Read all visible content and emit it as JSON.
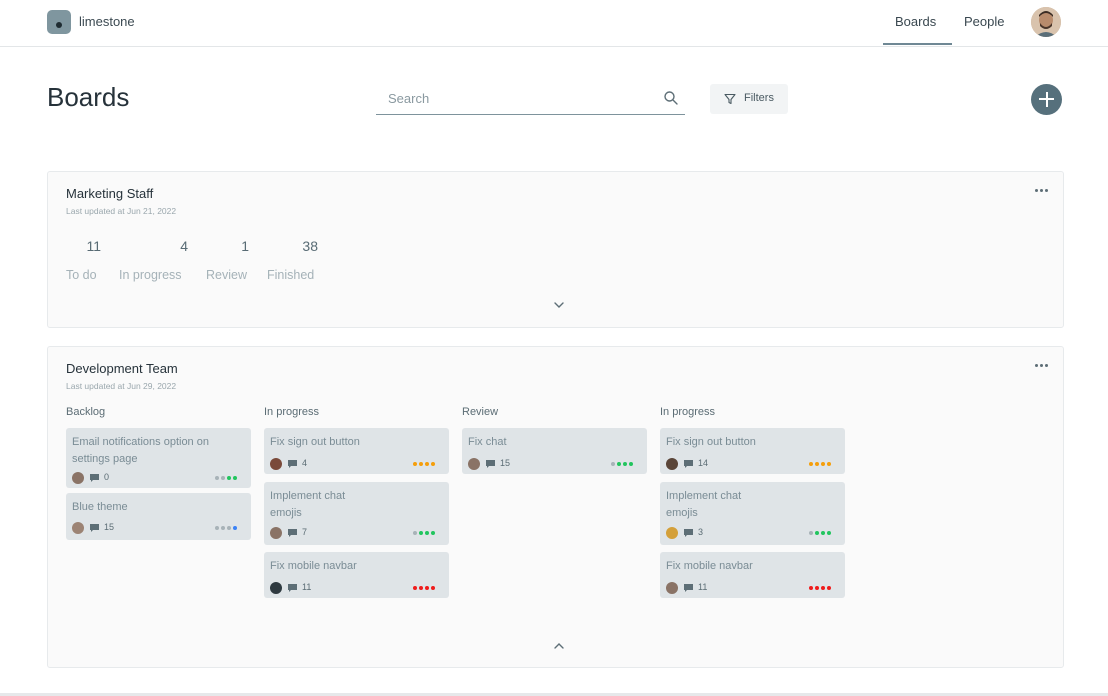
{
  "app": {
    "brand": "limestone"
  },
  "nav": {
    "boards": "Boards",
    "people": "People"
  },
  "page": {
    "title": "Boards"
  },
  "search": {
    "placeholder": "Search"
  },
  "filters": {
    "label": "Filters"
  },
  "colors": {
    "accent": "#56707c",
    "card": "#dfe4e7",
    "grey_dot": "#a8b3b8",
    "green": "#22c55e",
    "orange": "#f59e0b",
    "red": "#ef1c1c",
    "blue": "#3b82f6"
  },
  "boards": [
    {
      "name": "Marketing Staff",
      "updated": "Last updated at Jun 21, 2022",
      "stats": [
        {
          "value": "11",
          "label": "To do"
        },
        {
          "value": "4",
          "label": "In progress"
        },
        {
          "value": "1",
          "label": "Review"
        },
        {
          "value": "38",
          "label": "Finished"
        }
      ]
    },
    {
      "name": "Development Team",
      "updated": "Last updated at Jun 29, 2022",
      "columns": [
        {
          "title": "Backlog",
          "cards": [
            {
              "title": "Email notifications option on settings page",
              "comments": "0",
              "status": "green",
              "level": 2
            },
            {
              "title": "Blue theme",
              "comments": "15",
              "status": "blue",
              "level": 1
            }
          ]
        },
        {
          "title": "In progress",
          "cards": [
            {
              "title": "Fix sign out button",
              "comments": "4",
              "status": "orange",
              "level": 4
            },
            {
              "title": "Implement chat emojis",
              "comments": "7",
              "status": "green",
              "level": 3
            },
            {
              "title": "Fix mobile navbar",
              "comments": "11",
              "status": "red",
              "level": 4
            }
          ]
        },
        {
          "title": "Review",
          "cards": [
            {
              "title": "Fix chat",
              "comments": "15",
              "status": "green",
              "level": 3
            }
          ]
        },
        {
          "title": "In progress",
          "cards": [
            {
              "title": "Fix sign out button",
              "comments": "14",
              "status": "orange",
              "level": 4
            },
            {
              "title": "Implement chat emojis",
              "comments": "3",
              "status": "green",
              "level": 3
            },
            {
              "title": "Fix mobile navbar",
              "comments": "11",
              "status": "red",
              "level": 4
            }
          ]
        }
      ]
    }
  ]
}
